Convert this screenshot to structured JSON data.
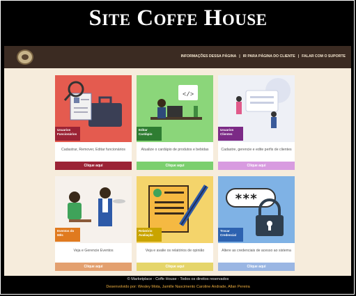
{
  "header": {
    "title": "Site Coffe House"
  },
  "nav": {
    "links": [
      "INFORMAÇÕES DESSA PÁGINA",
      "IR PARA PÁGINA DO CLIENTE",
      "FALAR COM O SUPORTE"
    ]
  },
  "cards": [
    {
      "tag": "Usuarios Funcionários",
      "desc": "Cadastrar, Remover, Editar funcionários",
      "button": "Clique aqui",
      "tag_color": "#9b2335",
      "btn_color": "#9b2335",
      "bg": "#e45b4f"
    },
    {
      "tag": "Editar Cardápio",
      "desc": "Atualize o cardápio de produtos e bebidas",
      "button": "Clique aqui",
      "tag_color": "#2e7d32",
      "btn_color": "#7bcf6e",
      "bg": "#8bd67a"
    },
    {
      "tag": "Usuarios Clientes",
      "desc": "Cadastre, gerencie e edite perfis de clientes",
      "button": "Clique aqui",
      "tag_color": "#7b2a86",
      "btn_color": "#d89be0",
      "bg": "#eef0f6"
    },
    {
      "tag": "Eventos do Mês",
      "desc": "Veja e Gerencie Eventos",
      "button": "Clique aqui",
      "tag_color": "#e07a1f",
      "btn_color": "#e3a06f",
      "bg": "#f6f1ec"
    },
    {
      "tag": "Relatório Avaliação",
      "desc": "Veja e avalie os relatórios de opinião",
      "button": "Clique aqui",
      "tag_color": "#c9a400",
      "btn_color": "#e5d56a",
      "bg": "#f4d46b"
    },
    {
      "tag": "Trocar Credencial",
      "desc": "Altere as credenciais de acesso ao sistema",
      "button": "Clique aqui",
      "tag_color": "#2d62b0",
      "btn_color": "#9ab6e3",
      "bg": "#7fb2e5"
    }
  ],
  "footer": {
    "line1": "© Marketplace - Coffe House - Todos os direitos reservados",
    "line2": "Desenvolvido por: Wesley Mota, Jamille Nascimento Caroline Andrade, Allan Pereira"
  }
}
